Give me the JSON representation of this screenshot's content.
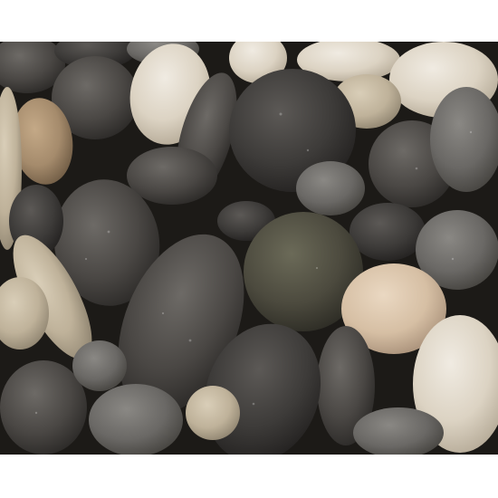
{
  "image": {
    "subject": "pebbles",
    "colors": {
      "background": "#ffffff",
      "gap_shadow": "#1c1a17",
      "dark_stone": "#4a4744",
      "charcoal_stone": "#3d3b39",
      "olive_stone": "#4c4a3e",
      "grey_stone": "#6a6865",
      "cream_stone": "#dcd3c3",
      "tan_stone": "#a58b6c",
      "peach_stone": "#d6bfa4"
    }
  }
}
